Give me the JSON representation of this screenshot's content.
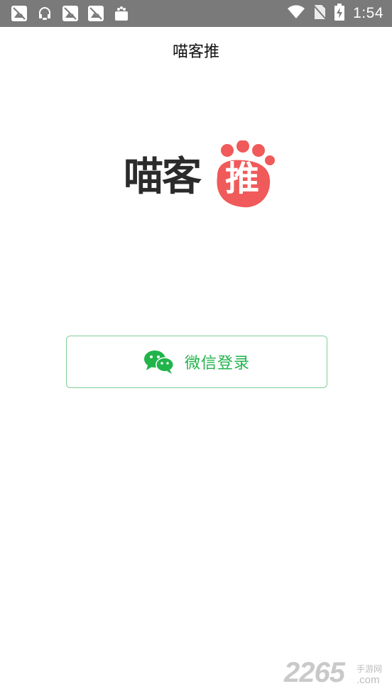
{
  "status_bar": {
    "time": "1:54",
    "notification_icons": [
      "no-image-icon",
      "headset-icon",
      "no-image-icon",
      "no-image-icon",
      "shop-bag-icon"
    ],
    "right_icons": [
      "wifi-icon",
      "no-sim-icon",
      "battery-charging-icon"
    ]
  },
  "header": {
    "title": "喵客推"
  },
  "logo": {
    "text": "喵客",
    "paw_char": "推",
    "paw_color": "#f05a5a"
  },
  "login": {
    "wechat_label": "微信登录",
    "accent_color": "#21b44b"
  },
  "watermark": {
    "number": "2265",
    "site_cn": "手游网",
    "domain": ".com"
  }
}
